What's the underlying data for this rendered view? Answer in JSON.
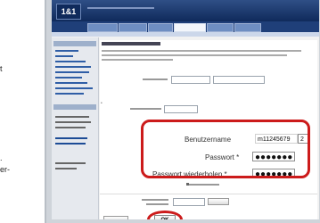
{
  "page_left": {
    "fragments": [
      "t",
      ".",
      "er-"
    ]
  },
  "header": {
    "logo": "1&1"
  },
  "form": {
    "username_label": "Benutzername",
    "username_value": "m11245679",
    "username_suffix": "2",
    "password_label": "Passwort *",
    "password_value": "●●●●●●●",
    "repeat_password_label": "Passwort wiederholen *",
    "repeat_password_value": "●●●●●●●"
  },
  "actions": {
    "ok_label": "OK"
  },
  "colors": {
    "highlight": "#cc1b1b",
    "nav": "#1f3f79",
    "logo_bg": "#0f2a5b"
  }
}
